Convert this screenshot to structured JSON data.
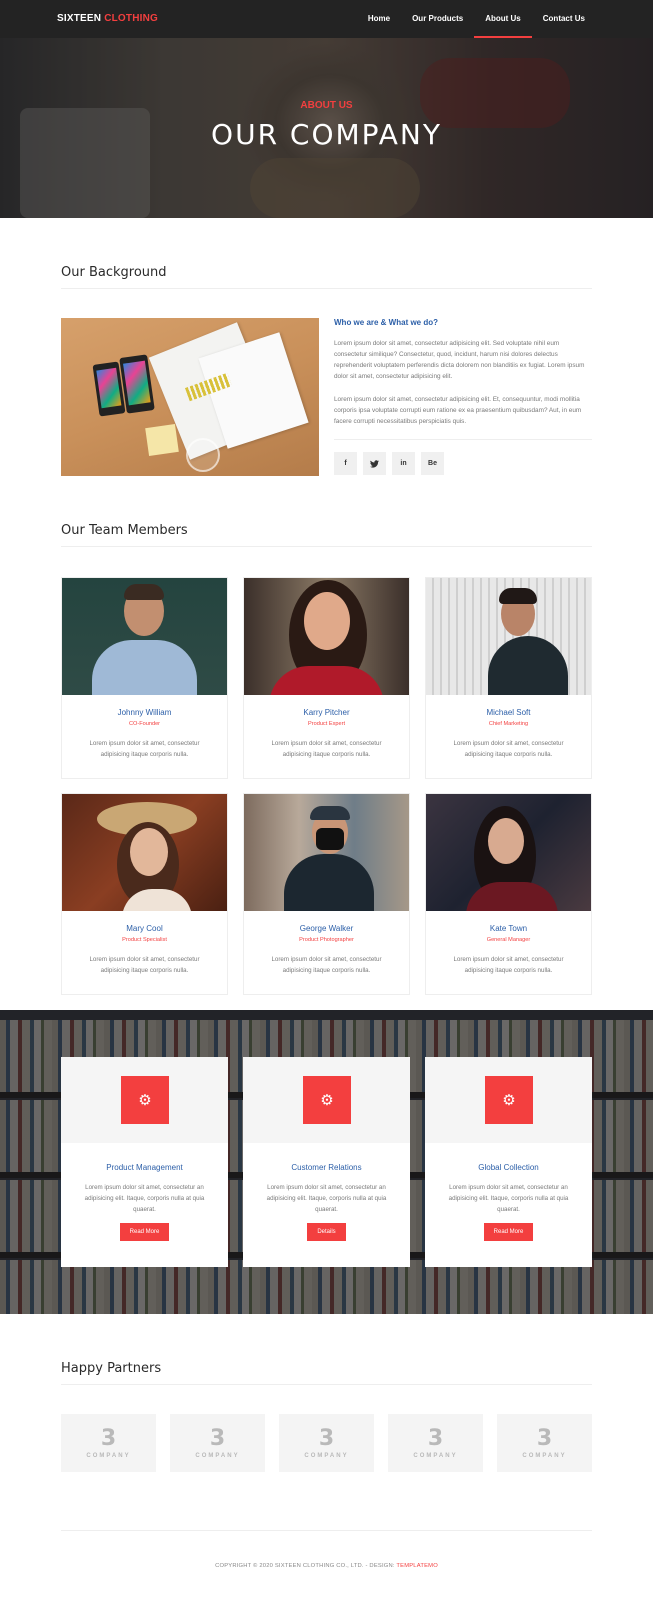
{
  "nav": {
    "brand_main": "SIXTEEN",
    "brand_accent": "CLOTHING",
    "links": [
      "Home",
      "Our Products",
      "About Us",
      "Contact Us"
    ],
    "active_index": 2
  },
  "hero": {
    "subtitle": "ABOUT US",
    "title": "OUR COMPANY"
  },
  "background": {
    "heading": "Our Background",
    "title": "Who we are & What we do?",
    "para1": "Lorem ipsum dolor sit amet, consectetur adipisicing elit. Sed voluptate nihil eum consectetur similique? Consectetur, quod, incidunt, harum nisi dolores delectus reprehenderit voluptatem perferendis dicta dolorem non blanditiis ex fugiat. Lorem ipsum dolor sit amet, consectetur adipisicing elit.",
    "para2": "Lorem ipsum dolor sit amet, consectetur adipisicing elit. Et, consequuntur, modi mollitia corporis ipsa voluptate corrupti eum ratione ex ea praesentium quibusdam? Aut, in eum facere corrupti necessitatibus perspiciatis quis.",
    "social": [
      "f",
      "t",
      "in",
      "Be"
    ],
    "social_icons": [
      "facebook-icon",
      "twitter-icon",
      "linkedin-icon",
      "behance-icon"
    ]
  },
  "team": {
    "heading": "Our Team Members",
    "members": [
      {
        "name": "Johnny William",
        "role": "CO-Founder",
        "desc": "Lorem ipsum dolor sit amet, consectetur adipisicing itaque corporis nulla."
      },
      {
        "name": "Karry Pitcher",
        "role": "Product Expert",
        "desc": "Lorem ipsum dolor sit amet, consectetur adipisicing itaque corporis nulla."
      },
      {
        "name": "Michael Soft",
        "role": "Chief Marketing",
        "desc": "Lorem ipsum dolor sit amet, consectetur adipisicing itaque corporis nulla."
      },
      {
        "name": "Mary Cool",
        "role": "Product Specialist",
        "desc": "Lorem ipsum dolor sit amet, consectetur adipisicing itaque corporis nulla."
      },
      {
        "name": "George Walker",
        "role": "Product Photographer",
        "desc": "Lorem ipsum dolor sit amet, consectetur adipisicing itaque corporis nulla."
      },
      {
        "name": "Kate Town",
        "role": "General Manager",
        "desc": "Lorem ipsum dolor sit amet, consectetur adipisicing itaque corporis nulla."
      }
    ]
  },
  "services": [
    {
      "title": "Product Management",
      "desc": "Lorem ipsum dolor sit amet, consectetur an adipisicing elit. Itaque, corporis nulla at quia quaerat.",
      "button": "Read More",
      "icon": "gear-icon"
    },
    {
      "title": "Customer Relations",
      "desc": "Lorem ipsum dolor sit amet, consectetur an adipisicing elit. Itaque, corporis nulla at quia quaerat.",
      "button": "Details",
      "icon": "gear-icon"
    },
    {
      "title": "Global Collection",
      "desc": "Lorem ipsum dolor sit amet, consectetur an adipisicing elit. Itaque, corporis nulla at quia quaerat.",
      "button": "Read More",
      "icon": "gear-icon"
    }
  ],
  "partners": {
    "heading": "Happy Partners",
    "items": [
      {
        "mark": "3",
        "text": "COMPANY"
      },
      {
        "mark": "3",
        "text": "COMPANY"
      },
      {
        "mark": "3",
        "text": "COMPANY"
      },
      {
        "mark": "3",
        "text": "COMPANY"
      },
      {
        "mark": "3",
        "text": "COMPANY"
      }
    ]
  },
  "footer": {
    "text": "COPYRIGHT © 2020 SIXTEEN CLOTHING CO., LTD. - DESIGN: ",
    "link": "TEMPLATEMO"
  },
  "colors": {
    "accent": "#f33f3f",
    "heading_blue": "#2c5fa8",
    "nav_bg": "#232323"
  }
}
